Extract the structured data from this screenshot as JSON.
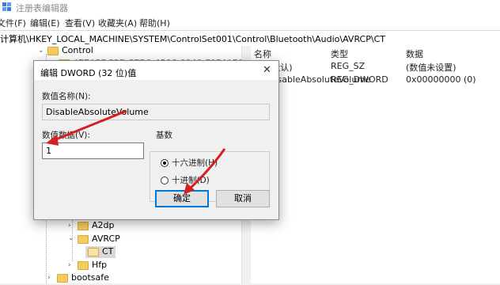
{
  "window": {
    "title": "注册表编辑器"
  },
  "menu": [
    "文件(F)",
    "编辑(E)",
    "查看(V)",
    "收藏夹(A)",
    "帮助(H)"
  ],
  "address": "计算机\\HKEY_LOCAL_MACHINE\\SYSTEM\\ControlSet001\\Control\\Bluetooth\\Audio\\AVRCP\\CT",
  "tree": {
    "items": [
      {
        "label": "Control"
      },
      {
        "label": "{E7A5DC3E-C7D0-4506-0040-F0F4AE000F7C}"
      },
      {
        "label": "A2dp"
      },
      {
        "label": "AVRCP"
      },
      {
        "label": "CT"
      },
      {
        "label": "Hfp"
      },
      {
        "label": "bootsafe"
      }
    ]
  },
  "list": {
    "columns": [
      "名称",
      "类型",
      "数据"
    ],
    "rows": [
      {
        "name": "(默认)",
        "type": "REG_SZ",
        "data": "(数值未设置)"
      },
      {
        "name": "DisableAbsoluteVolume",
        "type": "REG_DWORD",
        "data": "0x00000000 (0)"
      }
    ]
  },
  "dialog": {
    "title": "编辑 DWORD (32 位)值",
    "close": "✕",
    "name_label": "数值名称(N):",
    "name_value": "DisableAbsoluteVolume",
    "data_label": "数值数据(V):",
    "data_value": "1",
    "base_label": "基数",
    "hex_label": "十六进制(H)",
    "dec_label": "十进制(D)",
    "ok_label": "确定",
    "cancel_label": "取消",
    "selected_base": "hex"
  },
  "colors": {
    "accent": "#0078d7",
    "annotation_arrow": "#d42020",
    "folder": "#f5cc5e"
  }
}
